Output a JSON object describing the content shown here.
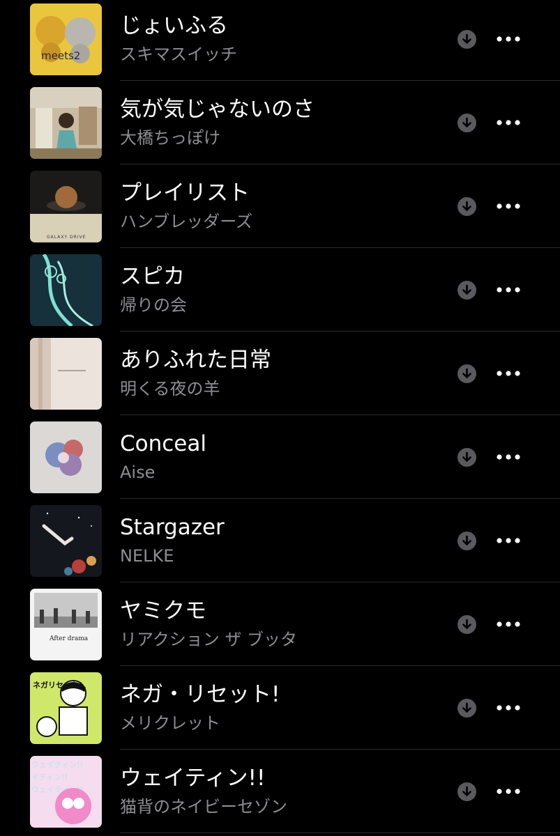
{
  "songs": [
    {
      "title": "じょいふる",
      "artist": "スキマスイッチ",
      "art_color": "#e8c840",
      "art_text": "meets2"
    },
    {
      "title": "気が気じゃないのさ",
      "artist": "大橋ちっぽけ",
      "art_color": "#c9b9a0",
      "art_text": ""
    },
    {
      "title": "プレイリスト",
      "artist": "ハンブレッダーズ",
      "art_color": "#d8cfb8",
      "art_text": "GALAXY DRIVE"
    },
    {
      "title": "スピカ",
      "artist": "帰りの会",
      "art_color": "#1f3a48",
      "art_text": ""
    },
    {
      "title": "ありふれた日常",
      "artist": "明くる夜の羊",
      "art_color": "#e8ded6",
      "art_text": ""
    },
    {
      "title": "Conceal",
      "artist": "Aise",
      "art_color": "#d9d6d4",
      "art_text": ""
    },
    {
      "title": "Stargazer",
      "artist": "NELKE",
      "art_color": "#1a1d24",
      "art_text": ""
    },
    {
      "title": "ヤミクモ",
      "artist": "リアクション ザ ブッタ",
      "art_color": "#f2f2f2",
      "art_text": "After drama"
    },
    {
      "title": "ネガ・リセット!",
      "artist": "メリクレット",
      "art_color": "#cde86a",
      "art_text": "ネガリセット!"
    },
    {
      "title": "ウェイティン!!",
      "artist": "猫背のネイビーセゾン",
      "art_color": "#f3d9ec",
      "art_text": "ウェイティン!!"
    }
  ],
  "icons": {
    "download": "download-circle-icon",
    "more": "ellipsis-icon"
  },
  "colors": {
    "background": "#000000",
    "title": "#ffffff",
    "subtitle": "#8e8e93",
    "divider": "#2c2c2e",
    "download_bg": "#5a5a5e"
  }
}
